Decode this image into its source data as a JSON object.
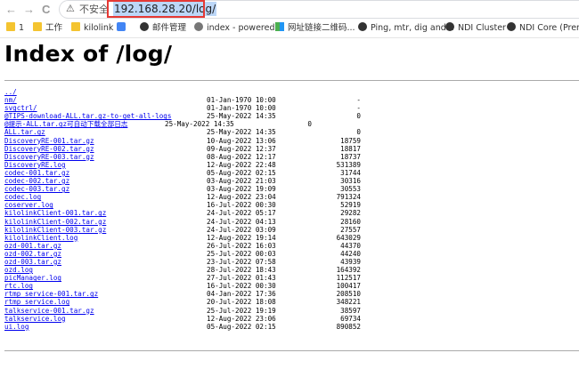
{
  "toolbar": {
    "back_glyph": "←",
    "forward_glyph": "→",
    "reload_glyph": "C",
    "security_warning": "不安全",
    "url": "192.168.28.20/log/"
  },
  "bookmarks": [
    {
      "label": "1",
      "icon": "folder-icon"
    },
    {
      "label": "工作",
      "icon": "folder-icon"
    },
    {
      "label": "kilolink",
      "icon": "folder-icon"
    },
    {
      "label": "",
      "icon": "translate-icon"
    },
    {
      "label": "邮件管理",
      "icon": "github-icon"
    },
    {
      "label": "index - powered...",
      "icon": "globe-icon"
    },
    {
      "label": "网址链接二维码...",
      "icon": "qr-icon"
    },
    {
      "label": "Ping, mtr, dig and...",
      "icon": "github-icon"
    },
    {
      "label": "NDI Cluster",
      "icon": "github-icon"
    },
    {
      "label": "NDI Core (Premiu...",
      "icon": "github-icon"
    }
  ],
  "page": {
    "title": "Index of /log/"
  },
  "entries": [
    {
      "name": "../",
      "date": "",
      "size": ""
    },
    {
      "name": "nm/",
      "date": "01-Jan-1970 10:00",
      "size": "-"
    },
    {
      "name": "svgctrl/",
      "date": "01-Jan-1970 10:00",
      "size": "-"
    },
    {
      "name": "@TIPS-download-ALL.tar.gz-to-get-all-logs",
      "date": "25-May-2022 14:35",
      "size": "0"
    },
    {
      "name": "@提示-ALL.tar.gz可自动下载全部日志",
      "date": "25-May-2022 14:35",
      "size": "0",
      "shift": true
    },
    {
      "name": "ALL.tar.gz",
      "date": "25-May-2022 14:35",
      "size": "0"
    },
    {
      "name": "DiscoveryRE-001.tar.gz",
      "date": "10-Aug-2022 13:06",
      "size": "18759"
    },
    {
      "name": "DiscoveryRE-002.tar.gz",
      "date": "09-Aug-2022 12:37",
      "size": "18817"
    },
    {
      "name": "DiscoveryRE-003.tar.gz",
      "date": "08-Aug-2022 12:17",
      "size": "18737"
    },
    {
      "name": "DiscoveryRE.log",
      "date": "12-Aug-2022 22:48",
      "size": "531389"
    },
    {
      "name": "codec-001.tar.gz",
      "date": "05-Aug-2022 02:15",
      "size": "31744"
    },
    {
      "name": "codec-002.tar.gz",
      "date": "03-Aug-2022 21:03",
      "size": "30316"
    },
    {
      "name": "codec-003.tar.gz",
      "date": "03-Aug-2022 19:09",
      "size": "30553"
    },
    {
      "name": "codec.log",
      "date": "12-Aug-2022 23:04",
      "size": "791324"
    },
    {
      "name": "coserver.log",
      "date": "16-Jul-2022 00:30",
      "size": "52919"
    },
    {
      "name": "kilolinkClient-001.tar.gz",
      "date": "24-Jul-2022 05:17",
      "size": "29282"
    },
    {
      "name": "kilolinkClient-002.tar.gz",
      "date": "24-Jul-2022 04:13",
      "size": "28160"
    },
    {
      "name": "kilolinkClient-003.tar.gz",
      "date": "24-Jul-2022 03:09",
      "size": "27557"
    },
    {
      "name": "kilolinkClient.log",
      "date": "12-Aug-2022 19:14",
      "size": "643029"
    },
    {
      "name": "ozd-001.tar.gz",
      "date": "26-Jul-2022 16:03",
      "size": "44370"
    },
    {
      "name": "ozd-002.tar.gz",
      "date": "25-Jul-2022 00:03",
      "size": "44240"
    },
    {
      "name": "ozd-003.tar.gz",
      "date": "23-Jul-2022 07:58",
      "size": "43939"
    },
    {
      "name": "ozd.log",
      "date": "28-Jul-2022 18:43",
      "size": "164392"
    },
    {
      "name": "picManager.log",
      "date": "27-Jul-2022 01:43",
      "size": "112517"
    },
    {
      "name": "rtc.log",
      "date": "16-Jul-2022 00:30",
      "size": "100417"
    },
    {
      "name": "rtmp_service-001.tar.gz",
      "date": "04-Jan-2022 17:36",
      "size": "208510"
    },
    {
      "name": "rtmp_service.log",
      "date": "20-Jul-2022 18:08",
      "size": "348221"
    },
    {
      "name": "talkservice-001.tar.gz",
      "date": "25-Jul-2022 19:19",
      "size": "38597"
    },
    {
      "name": "talkservice.log",
      "date": "12-Aug-2022 23:06",
      "size": "69734"
    },
    {
      "name": "ui.log",
      "date": "05-Aug-2022 02:15",
      "size": "890852"
    }
  ]
}
